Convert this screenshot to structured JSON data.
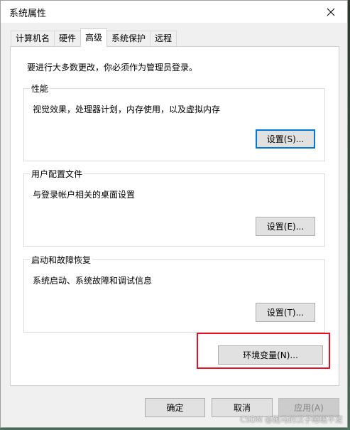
{
  "window": {
    "title": "系统属性"
  },
  "tabs": [
    {
      "label": "计算机名"
    },
    {
      "label": "硬件"
    },
    {
      "label": "高级"
    },
    {
      "label": "系统保护"
    },
    {
      "label": "远程"
    }
  ],
  "active_tab": "高级",
  "panel": {
    "admin_notice": "要进行大多数更改，你必须作为管理员登录。",
    "performance": {
      "title": "性能",
      "description": "视觉效果，处理器计划，内存使用，以及虚拟内存",
      "button": "设置(S)..."
    },
    "user_profiles": {
      "title": "用户配置文件",
      "description": "与登录帐户相关的桌面设置",
      "button": "设置(E)..."
    },
    "startup_recovery": {
      "title": "启动和故障恢复",
      "description": "系统启动、系统故障和调试信息",
      "button": "设置(T)..."
    },
    "env_button": "环境变量(N)..."
  },
  "footer": {
    "ok": "确定",
    "cancel": "取消",
    "apply": "应用(A)"
  },
  "watermark": "CSDN @跑马的汉子睡眠不足",
  "colors": {
    "focus_border": "#0078d7",
    "highlight": "#e81123"
  }
}
